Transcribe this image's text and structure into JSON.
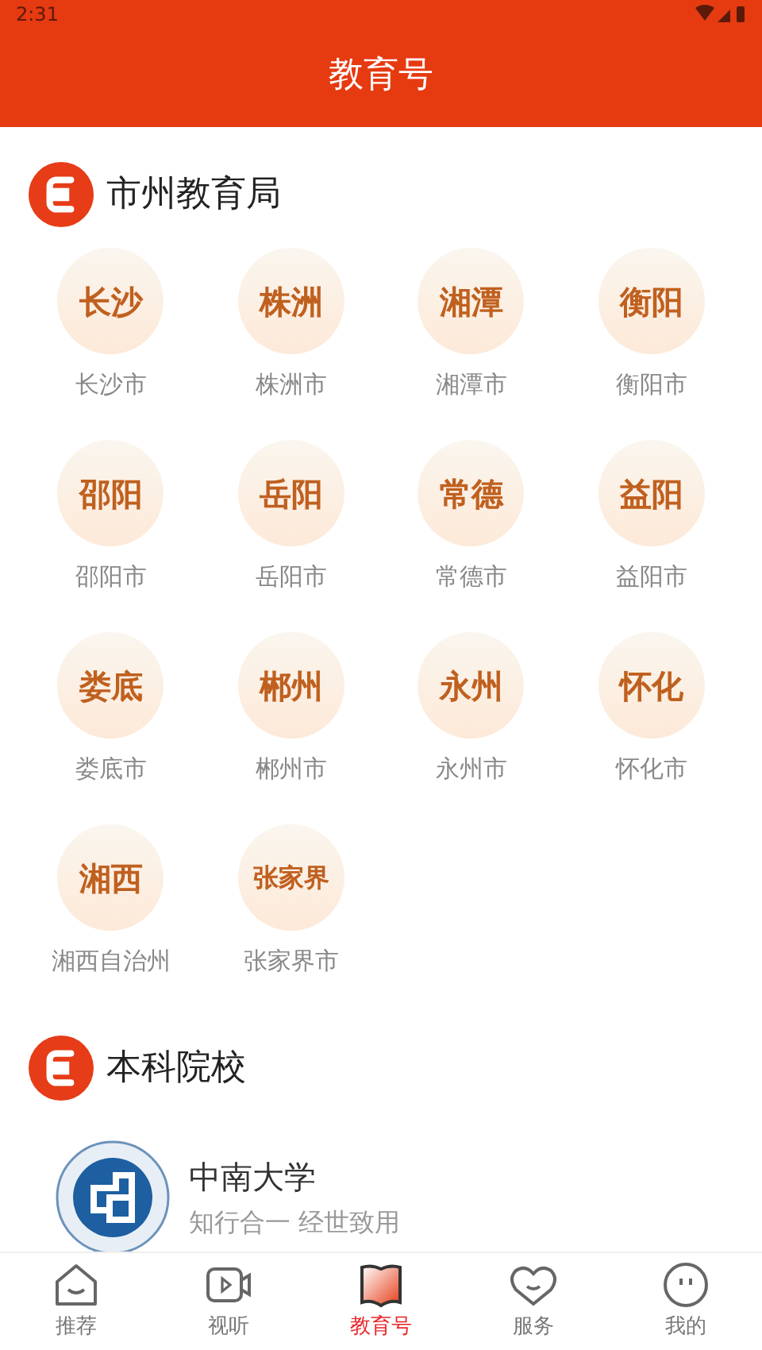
{
  "status_bar": {
    "time": "2:31"
  },
  "header": {
    "title": "教育号"
  },
  "sections": [
    {
      "title": "市州教育局",
      "kind": "cities",
      "items": [
        {
          "badge": "长沙",
          "label": "长沙市"
        },
        {
          "badge": "株洲",
          "label": "株洲市"
        },
        {
          "badge": "湘潭",
          "label": "湘潭市"
        },
        {
          "badge": "衡阳",
          "label": "衡阳市"
        },
        {
          "badge": "邵阳",
          "label": "邵阳市"
        },
        {
          "badge": "岳阳",
          "label": "岳阳市"
        },
        {
          "badge": "常德",
          "label": "常德市"
        },
        {
          "badge": "益阳",
          "label": "益阳市"
        },
        {
          "badge": "娄底",
          "label": "娄底市"
        },
        {
          "badge": "郴州",
          "label": "郴州市"
        },
        {
          "badge": "永州",
          "label": "永州市"
        },
        {
          "badge": "怀化",
          "label": "怀化市"
        },
        {
          "badge": "湘西",
          "label": "湘西自治州"
        },
        {
          "badge": "张家界",
          "label": "张家界市"
        }
      ]
    },
    {
      "title": "本科院校",
      "kind": "schools",
      "items": [
        {
          "name": "中南大学",
          "motto": "知行合一 经世致用"
        }
      ]
    }
  ],
  "tabs": [
    {
      "label": "推荐",
      "kind": "home",
      "selected": false
    },
    {
      "label": "视听",
      "kind": "video",
      "selected": false
    },
    {
      "label": "教育号",
      "kind": "edu",
      "selected": true
    },
    {
      "label": "服务",
      "kind": "heart",
      "selected": false
    },
    {
      "label": "我的",
      "kind": "face",
      "selected": false
    }
  ]
}
